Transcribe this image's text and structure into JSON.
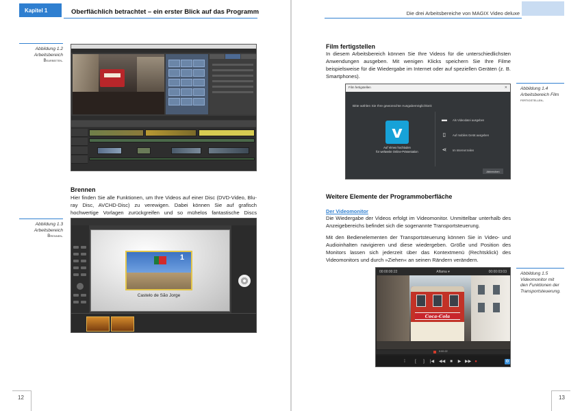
{
  "left_page": {
    "chapter_tab": "Kapitel 1",
    "header_title": "Oberflächlich betrachtet – ein erster Blick auf das Programm",
    "fig_1_2": {
      "label": "Abbildung 1.2",
      "line2": "Arbeitsbereich",
      "line3": "Bearbeiten."
    },
    "brennen_heading": "Brennen",
    "brennen_text": "Hier finden Sie alle Funktionen, um Ihre Videos auf einer Disc (DVD-Video, Blu-ray Disc, AVCHD-Disc) zu verewigen. Dabei können Sie auf grafisch hochwertige Vorlagen zurückgreifen und so mühelos fantastische Discs erstellen.",
    "fig_1_3": {
      "label": "Abbildung 1.3",
      "line2": "Arbeitsbereich",
      "line3": "Brennen."
    },
    "disc_menu_caption": "Castelo de São Jorge",
    "disc_menu_number": "1",
    "page_number": "12"
  },
  "right_page": {
    "header_title": "Die drei Arbeitsbereiche von MAGIX Video deluxe",
    "film_heading": "Film fertigstellen",
    "film_text": "In diesem Arbeitsbereich können Sie Ihre Videos für die unterschiedlichsten Anwendungen ausgeben. Mit wenigen Klicks speichern Sie Ihre Filme beispielsweise für die Wiedergabe im Internet oder auf speziellen Geräten (z. B. Smartphones).",
    "fig_1_4": {
      "label": "Abbildung 1.4",
      "line2": "Arbeitsbereich Film",
      "line3": "fertigstellen."
    },
    "export_dialog": {
      "title": "Film fertigstellen",
      "prompt": "Bitte wählen Sie Ihre gewünschte Ausgabemöglichkeit:",
      "vimeo_label_1": "Auf Vimeo hochladen",
      "vimeo_label_2": "für weltweite Online-Präsentation",
      "option_1": "Als Videodatei ausgeben",
      "option_2": "Auf mobiles Gerät ausgeben",
      "option_3": "Im Internet teilen",
      "cancel": "Abbrechen"
    },
    "weitere_heading": "Weitere Elemente der Programmoberfläche",
    "videomonitor_subheading": "Der Videomonitor",
    "videomonitor_text": "Die Wiedergabe der Videos erfolgt im Videomonitor. Unmittelbar unterhalb des Anzeigebereichs befindet sich die sogenannte Transportsteuerung.",
    "transport_text": "Mit den Bedienelementen der Transportsteuerung können Sie in Video- und Audioinhalten navigieren und diese wiedergeben. Größe und Position des Monitors lassen sich jederzeit über das Kontextmenü (Rechtsklick) des Videomonitors und durch »Ziehen« an seinen Rändern verändern.",
    "fig_1_5": {
      "label": "Abbildung 1.5",
      "line2": "Videomonitor mit",
      "line3": "den Funktionen der",
      "line4": "Transportsteuerung."
    },
    "monitor": {
      "time_left": "00:00:00:22",
      "title": "Alfama ▾",
      "time_right": "00:00:03:03",
      "timecode": "0:00:22",
      "ad": "Coca-Cola"
    },
    "page_number": "13"
  },
  "colors": {
    "accent": "#2f7fd0",
    "header_box": "#c9dcf2"
  }
}
